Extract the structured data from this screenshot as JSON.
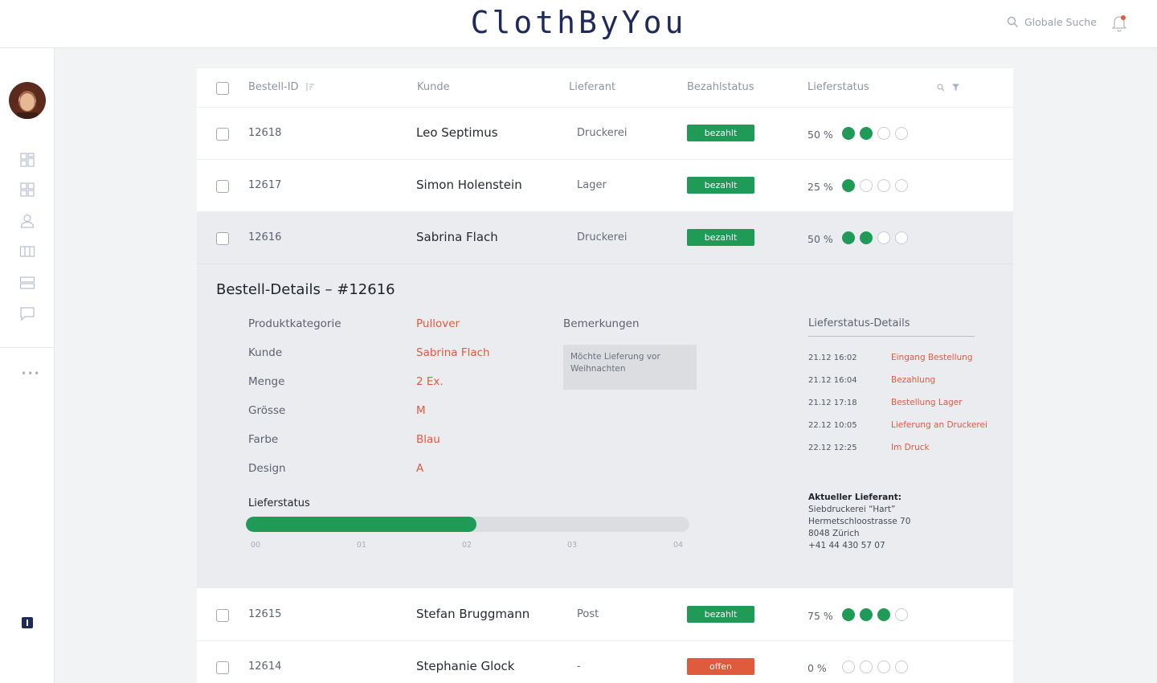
{
  "brand": "ClothByYou",
  "search": {
    "label": "Globale Suche"
  },
  "table": {
    "headers": {
      "id": "Bestell-ID",
      "kunde": "Kunde",
      "lieferant": "Lieferant",
      "bezahlstatus": "Bezahlstatus",
      "lieferstatus": "Lieferstatus"
    },
    "rows": [
      {
        "id": "12618",
        "kunde": "Leo Septimus",
        "lieferant": "Druckerei",
        "status": "bezahlt",
        "pct": "50 %",
        "progress": 2
      },
      {
        "id": "12617",
        "kunde": "Simon Holenstein",
        "lieferant": "Lager",
        "status": "bezahlt",
        "pct": "25 %",
        "progress": 1
      },
      {
        "id": "12616",
        "kunde": "Sabrina Flach",
        "lieferant": "Druckerei",
        "status": "bezahlt",
        "pct": "50 %",
        "progress": 2
      },
      {
        "id": "12615",
        "kunde": "Stefan Bruggmann",
        "lieferant": "Post",
        "status": "bezahlt",
        "pct": "75 %",
        "progress": 3
      },
      {
        "id": "12614",
        "kunde": "Stephanie Glock",
        "lieferant": "-",
        "status": "offen",
        "pct": "0 %",
        "progress": 0
      }
    ]
  },
  "details": {
    "title": "Bestell-Details – #12616",
    "fields": [
      {
        "label": "Produktkategorie",
        "value": "Pullover"
      },
      {
        "label": "Kunde",
        "value": "Sabrina Flach"
      },
      {
        "label": "Menge",
        "value": "2 Ex."
      },
      {
        "label": "Grösse",
        "value": "M"
      },
      {
        "label": "Farbe",
        "value": "Blau"
      },
      {
        "label": "Design",
        "value": "A"
      }
    ],
    "bemerkungen_label": "Bemerkungen",
    "bemerkungen_text": "Möchte Lieferung vor Weihnachten",
    "lieferstatus_label": "Lieferstatus",
    "lieferstatus_progress": 0.52,
    "ticks": [
      "00",
      "01",
      "02",
      "03",
      "04"
    ],
    "ls_details_title": "Lieferstatus-Details",
    "events": [
      {
        "date": "21.12 16:02",
        "label": "Eingang Bestellung"
      },
      {
        "date": "21.12 16:04",
        "label": "Bezahlung"
      },
      {
        "date": "21.12 17:18",
        "label": "Bestellung Lager"
      },
      {
        "date": "22.12 10:05",
        "label": "Lieferung an Druckerei"
      },
      {
        "date": "22.12 12:25",
        "label": "Im Druck"
      }
    ],
    "supplier": {
      "heading": "Aktueller Lieferant:",
      "name": "Siebdruckerei “Hart”",
      "street": "Hermetschloostrasse 70",
      "city": "8048 Zürich",
      "phone": "+41 44 430 57 07"
    }
  },
  "colors": {
    "brand": "#1f2a5c",
    "paid": "#1f9b57",
    "open": "#e05a3c"
  }
}
